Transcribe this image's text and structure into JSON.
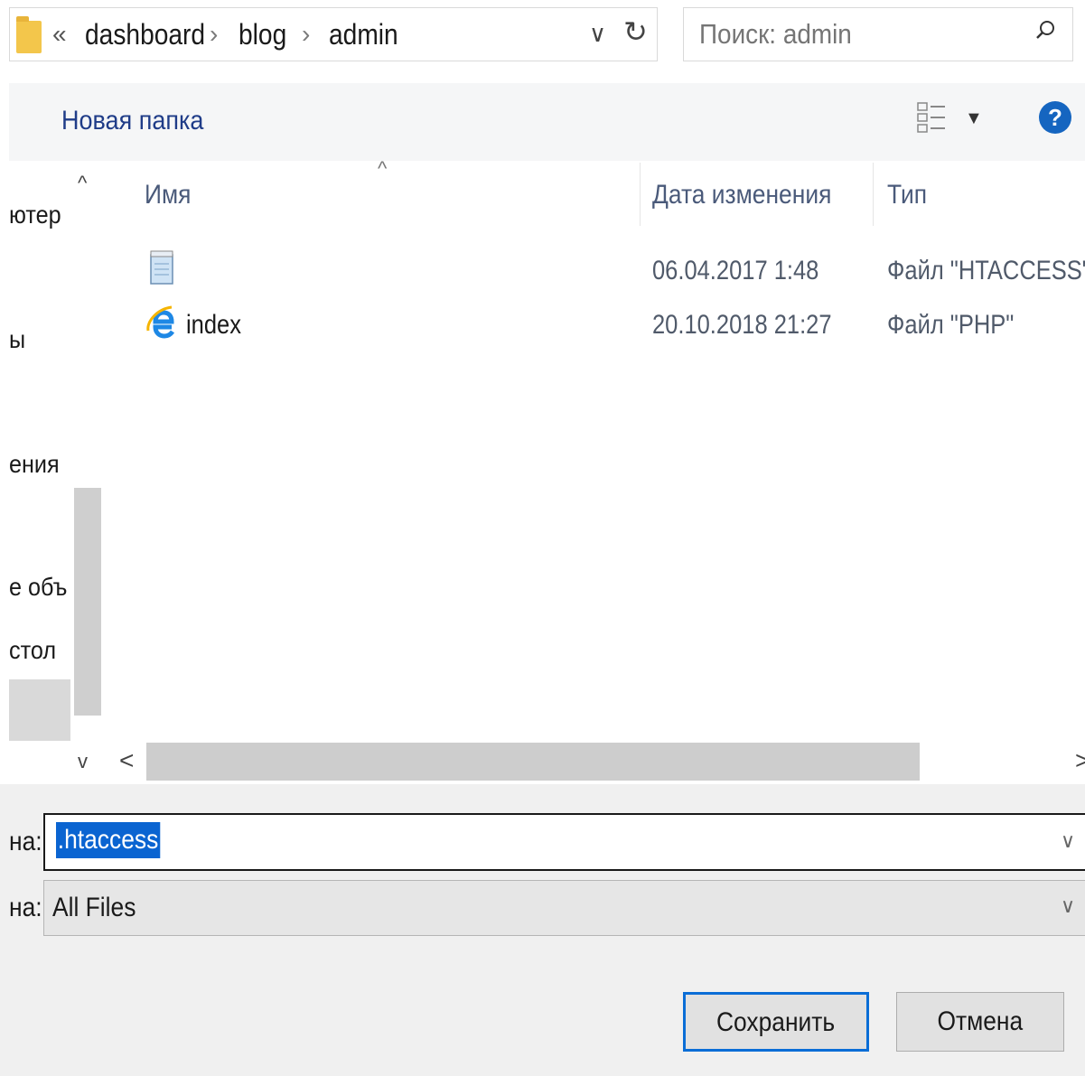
{
  "address_bar": {
    "overflow_chevron": "«",
    "breadcrumbs": [
      "dashboard",
      "blog",
      "admin"
    ],
    "separator": "›",
    "dropdown_glyph": "∨",
    "refresh_glyph": "↻"
  },
  "search": {
    "value": "Поиск: admin"
  },
  "toolbar": {
    "new_folder_label": "Новая папка",
    "help_label": "?"
  },
  "nav_pane": {
    "items": [
      "ютер",
      "ы",
      "ения",
      "е объ",
      "стол"
    ],
    "scroll_up": "^",
    "scroll_down": "v"
  },
  "columns": {
    "name": "Имя",
    "modified": "Дата изменения",
    "type": "Тип",
    "sort_indicator": "^"
  },
  "files": [
    {
      "name": "",
      "modified": "06.04.2017 1:48",
      "type": "Файл \"HTACCESS\"",
      "icon": "notepad-icon"
    },
    {
      "name": "index",
      "modified": "20.10.2018 21:27",
      "type": "Файл \"PHP\"",
      "icon": "internet-explorer-icon"
    }
  ],
  "h_scroll": {
    "left": "<",
    "right": ">"
  },
  "form": {
    "filename_label": "на:",
    "filename_value": ".htaccess",
    "filetype_label": "на:",
    "filetype_value": "All Files",
    "dropdown_glyph": "∨"
  },
  "buttons": {
    "save": "Сохранить",
    "cancel": "Отмена"
  },
  "colors": {
    "accent": "#0a6dd6",
    "selection": "#0a64d1",
    "help": "#1565c0",
    "folder": "#f3c64b"
  }
}
